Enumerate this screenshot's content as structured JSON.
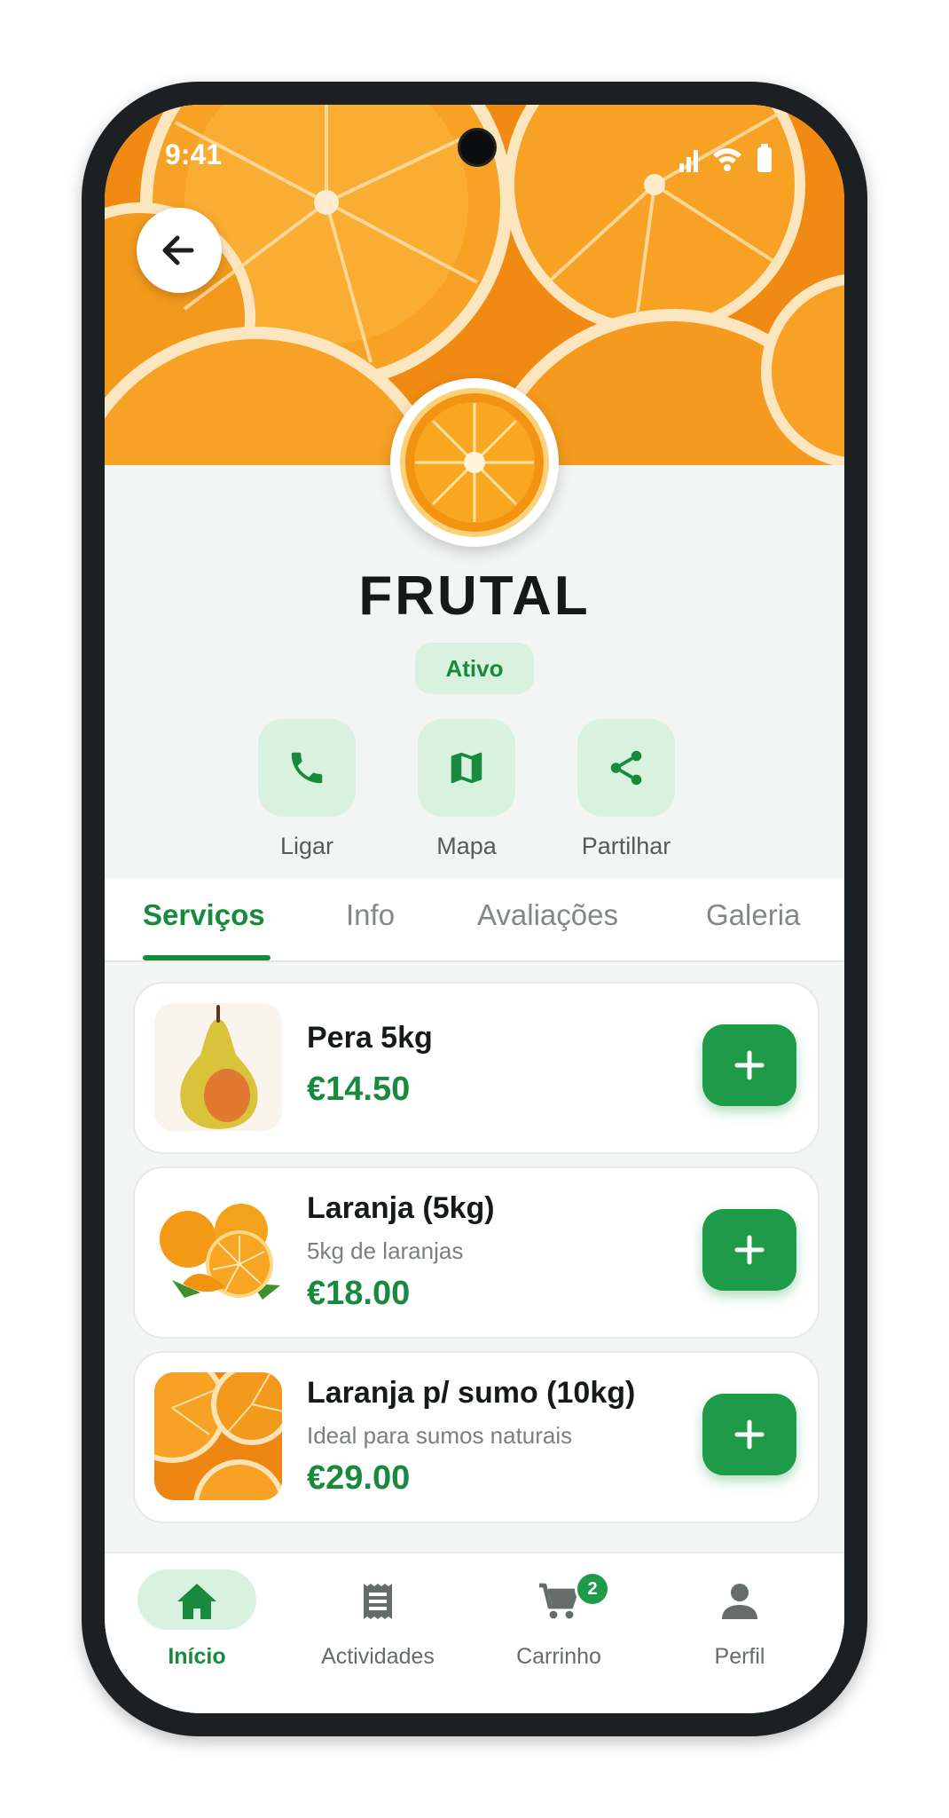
{
  "status_bar": {
    "time": "9:41"
  },
  "header": {
    "back_icon": "arrow-left-icon",
    "logo_icon": "orange-slice-icon"
  },
  "store": {
    "name": "FRUTAL",
    "status": "Ativo"
  },
  "actions": [
    {
      "label": "Ligar",
      "icon": "phone-icon"
    },
    {
      "label": "Mapa",
      "icon": "map-icon"
    },
    {
      "label": "Partilhar",
      "icon": "share-icon"
    }
  ],
  "tabs": [
    {
      "label": "Serviços",
      "active": true
    },
    {
      "label": "Info",
      "active": false
    },
    {
      "label": "Avaliações",
      "active": false
    },
    {
      "label": "Galeria",
      "active": false
    }
  ],
  "products": [
    {
      "name": "Pera 5kg",
      "description": "",
      "price": "€14.50",
      "image": "pear-image"
    },
    {
      "name": "Laranja (5kg)",
      "description": "5kg de laranjas",
      "price": "€18.00",
      "image": "oranges-image"
    },
    {
      "name": "Laranja p/ sumo (10kg)",
      "description": "Ideal para sumos naturais",
      "price": "€29.00",
      "image": "orange-slices-image"
    }
  ],
  "bottom_nav": [
    {
      "label": "Início",
      "icon": "home-icon",
      "active": true
    },
    {
      "label": "Actividades",
      "icon": "receipt-icon",
      "active": false
    },
    {
      "label": "Carrinho",
      "icon": "cart-icon",
      "active": false,
      "badge": "2"
    },
    {
      "label": "Perfil",
      "icon": "person-icon",
      "active": false
    }
  ],
  "colors": {
    "accent": "#178a3e",
    "accent_light": "#d9f2df",
    "button": "#1f9a48",
    "text": "#151a18"
  }
}
